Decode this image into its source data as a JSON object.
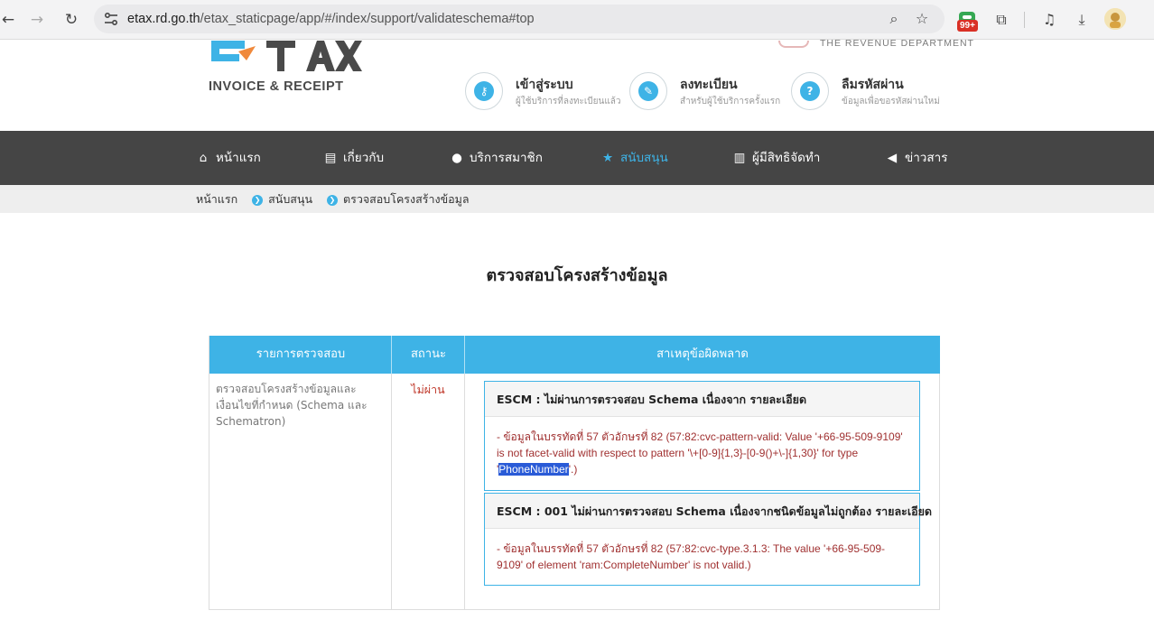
{
  "browser": {
    "url_domain": "etax.rd.go.th",
    "url_path": "/etax_staticpage/app/#/index/support/validateschema#top",
    "badge_count": "99+"
  },
  "header": {
    "logo_caption": "INVOICE & RECEIPT",
    "department": "THE REVENUE DEPARTMENT",
    "actions": [
      {
        "title": "เข้าสู่ระบบ",
        "subtitle": "ผู้ใช้บริการที่ลงทะเบียนแล้ว",
        "icon": "key-icon"
      },
      {
        "title": "ลงทะเบียน",
        "subtitle": "สำหรับผู้ใช้บริการครั้งแรก",
        "icon": "edit-icon"
      },
      {
        "title": "ลืมรหัสผ่าน",
        "subtitle": "ข้อมูลเพื่อขอรหัสผ่านใหม่",
        "icon": "question-icon"
      }
    ]
  },
  "nav": {
    "items": [
      {
        "label": "หน้าแรก",
        "icon": "home-icon"
      },
      {
        "label": "เกี่ยวกับ",
        "icon": "document-icon"
      },
      {
        "label": "บริการสมาชิก",
        "icon": "user-icon"
      },
      {
        "label": "สนับสนุน",
        "icon": "star-icon"
      },
      {
        "label": "ผู้มีสิทธิจัดทำ",
        "icon": "book-icon"
      },
      {
        "label": "ข่าวสาร",
        "icon": "megaphone-icon"
      }
    ],
    "active_color": "#3eb3e6"
  },
  "breadcrumb": [
    "หน้าแรก",
    "สนับสนุน",
    "ตรวจสอบโครงสร้างข้อมูล"
  ],
  "page": {
    "title": "ตรวจสอบโครงสร้างข้อมูล"
  },
  "table": {
    "headers": [
      "รายการตรวจสอบ",
      "สถานะ",
      "สาเหตุข้อผิดพลาด"
    ],
    "row": {
      "item": "ตรวจสอบโครงสร้างข้อมูลและเงื่อนไขที่กำหนด (Schema และ Schematron)",
      "status": "ไม่ผ่าน"
    },
    "errors": [
      {
        "title": "ESCM : ไม่ผ่านการตรวจสอบ Schema เนื่องจาก รายละเอียด",
        "detail_before": "- ข้อมูลในบรรทัดที่ 57 ตัวอักษรที่ 82 (57:82:cvc-pattern-valid: Value '+66-95-509-9109' is not facet-valid with respect to pattern '\\+[0-9]{1,3}-[0-9()+\\-]{1,30}' for type '",
        "detail_highlight": "PhoneNumber",
        "detail_after": "'.)"
      },
      {
        "title": "ESCM : 001 ไม่ผ่านการตรวจสอบ Schema เนื่องจากชนิดข้อมูลไม่ถูกต้อง รายละเอียด",
        "detail_before": "- ข้อมูลในบรรทัดที่ 57 ตัวอักษรที่ 82 (57:82:cvc-type.3.1.3: The value '+66-95-509- 9109' of element 'ram:CompleteNumber' is not valid.)",
        "detail_highlight": "",
        "detail_after": ""
      }
    ]
  },
  "colors": {
    "accent": "#3eb3e6",
    "nav_bg": "#454545",
    "error_text": "#a03030"
  }
}
